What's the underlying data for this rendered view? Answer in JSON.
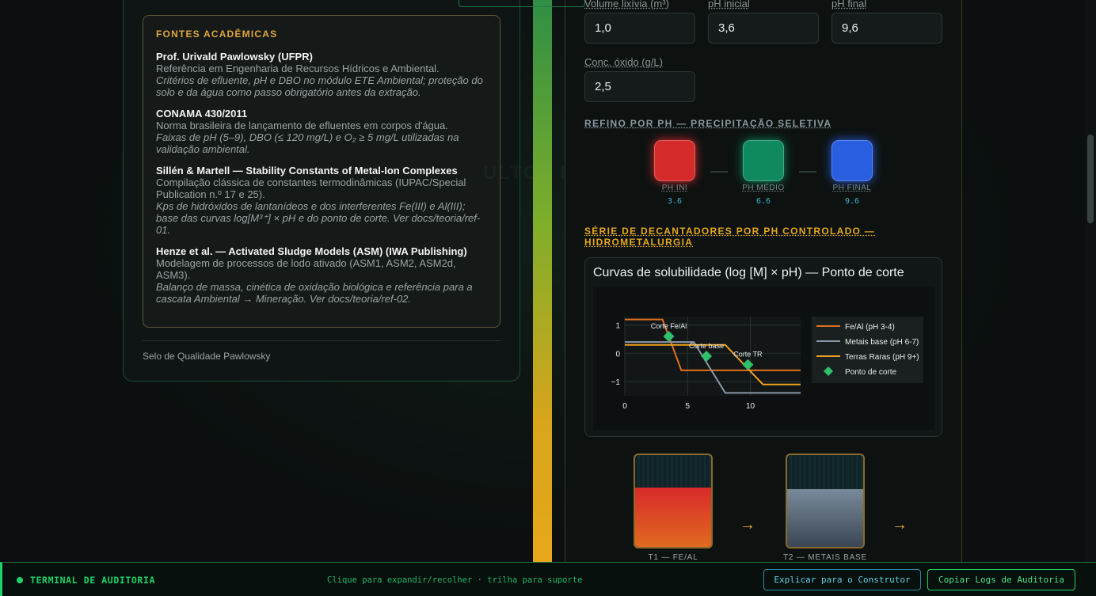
{
  "sources": {
    "title": "FONTES ACADÊMICAS",
    "items": [
      {
        "name": "Prof. Urivald Pawlowsky (UFPR)",
        "desc": "Referência em Engenharia de Recursos Hídricos e Ambiental.",
        "note": "Critérios de efluente, pH e DBO no módulo ETE Ambiental; proteção do solo e da água como passo obrigatório antes da extração."
      },
      {
        "name": "CONAMA 430/2011",
        "desc": "Norma brasileira de lançamento de efluentes em corpos d'água.",
        "note": "Faixas de pH (5–9), DBO (≤ 120 mg/L) e O₂ ≥ 5 mg/L utilizadas na validação ambiental."
      },
      {
        "name": "Sillén & Martell — Stability Constants of Metal-Ion Complexes",
        "desc": "Compilação clássica de constantes termodinâmicas (IUPAC/Special Publication n.º 17 e 25).",
        "note": "Kps de hidróxidos de lantanídeos e dos interferentes Fe(III) e Al(III); base das curvas log[M³⁺] × pH e do ponto de corte. Ver docs/teoria/ref-01."
      },
      {
        "name": "Henze et al. — Activated Sludge Models (ASM) (IWA Publishing)",
        "desc": "Modelagem de processos de lodo ativado (ASM1, ASM2, ASM2d, ASM3).",
        "note": "Balanço de massa, cinética de oxidação biológica e referência para a cascata Ambiental → Mineração. Ver docs/teoria/ref-02."
      }
    ],
    "seal": "Selo de Qualidade Pawlowsky"
  },
  "watermark": "ULTO / ETE",
  "inputs": {
    "volume": {
      "label": "Volume lixívia (m³)",
      "value": "1,0"
    },
    "ph_initial": {
      "label": "pH inicial",
      "value": "3,6"
    },
    "ph_final": {
      "label": "pH final",
      "value": "9,6"
    },
    "oxide": {
      "label": "Conc. óxido (g/L)",
      "value": "2,5"
    }
  },
  "refine": {
    "heading": "REFINO POR PH — PRECIPITAÇÃO SELETIVA",
    "tiles": [
      {
        "label": "PH INI",
        "value": "3.6",
        "color": "#d42a2a"
      },
      {
        "label": "PH MÉDIO",
        "value": "6.6",
        "color": "#0f8a5f"
      },
      {
        "label": "PH FINAL",
        "value": "9.6",
        "color": "#2a5ee0"
      }
    ]
  },
  "series_heading": "SÉRIE DE DECANTADORES POR PH CONTROLADO — HIDROMETALURGIA",
  "chart_data": {
    "type": "line",
    "title": "Curvas de solubilidade (log [M] × pH) — Ponto de corte",
    "xlim": [
      0,
      14
    ],
    "ylim": [
      -1.5,
      1.3
    ],
    "xticks": [
      "0",
      "5",
      "10"
    ],
    "yticks": [
      "1",
      "0",
      "−1"
    ],
    "grid": true,
    "legend_position": "right",
    "series": [
      {
        "name": "Fe/Al (pH 3-4)",
        "color": "#e07020",
        "x": [
          0,
          3,
          4.5,
          14
        ],
        "y": [
          1.2,
          1.2,
          -0.6,
          -0.6
        ]
      },
      {
        "name": "Metais base (pH 6-7)",
        "color": "#8a98a8",
        "x": [
          0,
          5.5,
          8,
          14
        ],
        "y": [
          0.4,
          0.4,
          -1.4,
          -1.4
        ]
      },
      {
        "name": "Terras Raras (pH 9+)",
        "color": "#f0a020",
        "x": [
          0,
          8,
          11,
          14
        ],
        "y": [
          0.3,
          0.3,
          -1.1,
          -1.1
        ]
      },
      {
        "name": "Ponto de corte",
        "color": "#2fc06a",
        "marker": "diamond",
        "points": [
          {
            "x": 3.5,
            "y": 0.6,
            "label": "Corte Fe/Al"
          },
          {
            "x": 6.5,
            "y": -0.1,
            "label": "Corte base"
          },
          {
            "x": 9.8,
            "y": -0.4,
            "label": "Corte TR"
          }
        ]
      }
    ]
  },
  "tanks": [
    {
      "label": "T1 — FE/AL",
      "fill_fraction": 0.65,
      "fill_top": "#d82a2a",
      "fill_bottom": "#e06a20"
    },
    {
      "label": "T2 — METAIS BASE",
      "fill_fraction": 0.63,
      "fill_top": "#7a8a9a",
      "fill_bottom": "#3a4654"
    }
  ],
  "terminal": {
    "title": "TERMINAL DE AUDITORIA",
    "hint": "Clique para expandir/recolher · trilha para suporte",
    "explain_button": "Explicar para o Construtor",
    "copy_button": "Copiar Logs de Auditoria"
  }
}
